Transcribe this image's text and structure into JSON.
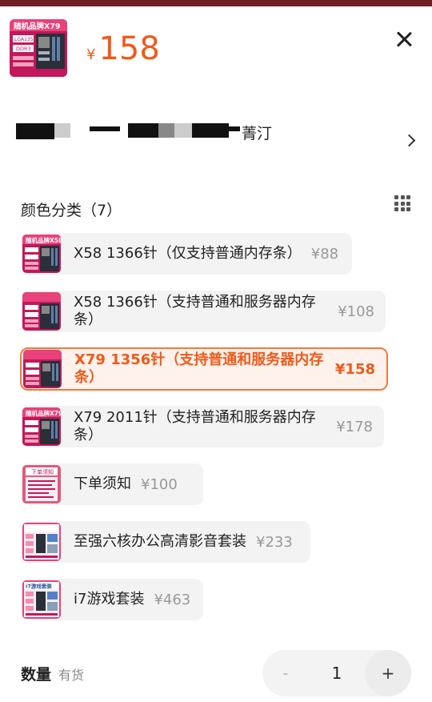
{
  "header": {
    "thumb_title": "随机品牌X79",
    "thumb_lines": [
      "LGA1356",
      "DDR3"
    ],
    "price_currency": "¥",
    "price_value": "158"
  },
  "address": {
    "text": "菁汀"
  },
  "options_section": {
    "title": "颜色分类（7）"
  },
  "options": [
    {
      "label": "X58 1366针（仅支持普通内存条）",
      "price": "¥88",
      "selected": false,
      "thumb": "board",
      "thumb_title": "随机品牌X58"
    },
    {
      "label": "X58 1366针（支持普通和服务器内存条）",
      "price": "¥108",
      "selected": false,
      "thumb": "board",
      "thumb_title": ""
    },
    {
      "label": "X79 1356针（支持普通和服务器内存条）",
      "price": "¥158",
      "selected": true,
      "thumb": "board",
      "thumb_title": ""
    },
    {
      "label": "X79 2011针（支持普通和服务器内存条）",
      "price": "¥178",
      "selected": false,
      "thumb": "board",
      "thumb_title": "随机品牌X79"
    },
    {
      "label": "下单须知",
      "price": "¥100",
      "selected": false,
      "thumb": "notice",
      "thumb_title": "下单须知"
    },
    {
      "label": "至强六核办公高清影音套装",
      "price": "¥233",
      "selected": false,
      "thumb": "bundle",
      "thumb_title": ""
    },
    {
      "label": "i7游戏套装",
      "price": "¥463",
      "selected": false,
      "thumb": "bundle",
      "thumb_title": "i7游戏套装"
    }
  ],
  "quantity": {
    "label": "数量",
    "stock": "有货",
    "minus": "-",
    "value": "1",
    "plus": "+"
  },
  "colors": {
    "accent": "#f05a1a",
    "thumb_red": "#c2185b"
  },
  "icons": [
    "close-icon",
    "chevron-right-icon",
    "grid-view-icon"
  ]
}
